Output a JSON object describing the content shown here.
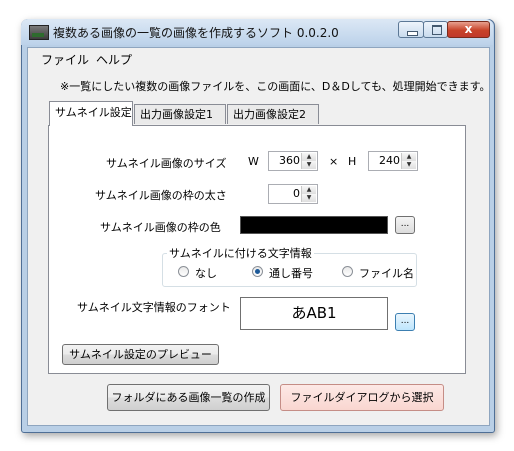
{
  "window": {
    "title": "複数ある画像の一覧の画像を作成するソフト 0.0.2.0",
    "close_glyph": "x"
  },
  "menu": [
    {
      "label": "ファイル"
    },
    {
      "label": "ヘルプ"
    }
  ],
  "notice": "※一覧にしたい複数の画像ファイルを、この画面に、D＆Dしても、処理開始できます。",
  "tabs": [
    {
      "label": "サムネイル設定",
      "active": true
    },
    {
      "label": "出力画像設定1",
      "active": false
    },
    {
      "label": "出力画像設定2",
      "active": false
    }
  ],
  "thumbnail": {
    "size_label": "サムネイル画像のサイズ",
    "w_label": "W",
    "width": "360",
    "times": "×",
    "h_label": "H",
    "height": "240",
    "border_width_label": "サムネイル画像の枠の太さ",
    "border_width": "0",
    "border_color_label": "サムネイル画像の枠の色",
    "border_color": "#000000",
    "browse_label": "...",
    "text_info_group": "サムネイルに付ける文字情報",
    "options": [
      {
        "label": "なし",
        "checked": false
      },
      {
        "label": "通し番号",
        "checked": true
      },
      {
        "label": "ファイル名",
        "checked": false
      }
    ],
    "font_label": "サムネイル文字情報のフォント",
    "font_sample": "あAB1",
    "font_browse_label": "...",
    "preview_button": "サムネイル設定のプレビュー"
  },
  "actions": {
    "create_from_folder": "フォルダにある画像一覧の作成",
    "select_from_dialog": "ファイルダイアログから選択"
  },
  "spin_up_glyph": "▲",
  "spin_down_glyph": "▼",
  "colors": {
    "titlebar": "#c4d8ee",
    "close_button": "#c8432a",
    "dialog_button_accent": "#f9d6d0"
  }
}
